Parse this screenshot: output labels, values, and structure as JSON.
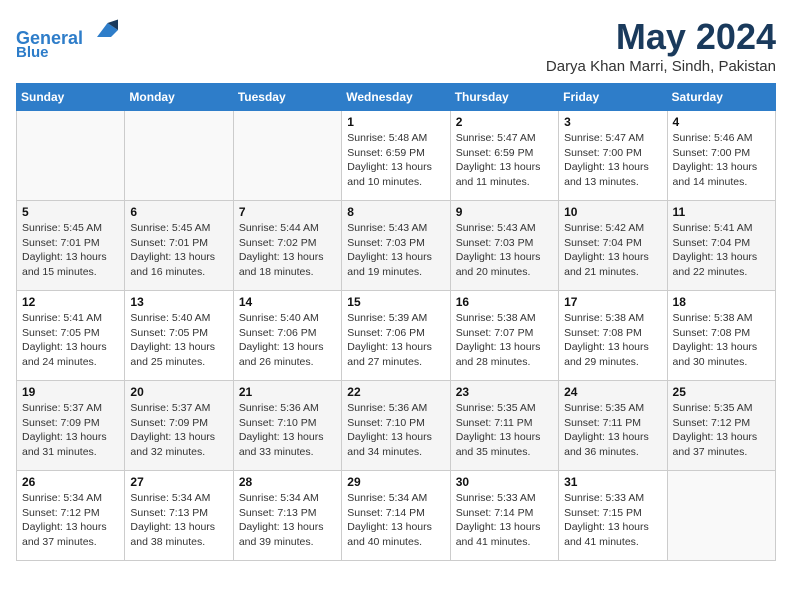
{
  "header": {
    "logo_line1": "General",
    "logo_line2": "Blue",
    "month": "May 2024",
    "location": "Darya Khan Marri, Sindh, Pakistan"
  },
  "weekdays": [
    "Sunday",
    "Monday",
    "Tuesday",
    "Wednesday",
    "Thursday",
    "Friday",
    "Saturday"
  ],
  "weeks": [
    [
      {
        "day": "",
        "info": ""
      },
      {
        "day": "",
        "info": ""
      },
      {
        "day": "",
        "info": ""
      },
      {
        "day": "1",
        "info": "Sunrise: 5:48 AM\nSunset: 6:59 PM\nDaylight: 13 hours\nand 10 minutes."
      },
      {
        "day": "2",
        "info": "Sunrise: 5:47 AM\nSunset: 6:59 PM\nDaylight: 13 hours\nand 11 minutes."
      },
      {
        "day": "3",
        "info": "Sunrise: 5:47 AM\nSunset: 7:00 PM\nDaylight: 13 hours\nand 13 minutes."
      },
      {
        "day": "4",
        "info": "Sunrise: 5:46 AM\nSunset: 7:00 PM\nDaylight: 13 hours\nand 14 minutes."
      }
    ],
    [
      {
        "day": "5",
        "info": "Sunrise: 5:45 AM\nSunset: 7:01 PM\nDaylight: 13 hours\nand 15 minutes."
      },
      {
        "day": "6",
        "info": "Sunrise: 5:45 AM\nSunset: 7:01 PM\nDaylight: 13 hours\nand 16 minutes."
      },
      {
        "day": "7",
        "info": "Sunrise: 5:44 AM\nSunset: 7:02 PM\nDaylight: 13 hours\nand 18 minutes."
      },
      {
        "day": "8",
        "info": "Sunrise: 5:43 AM\nSunset: 7:03 PM\nDaylight: 13 hours\nand 19 minutes."
      },
      {
        "day": "9",
        "info": "Sunrise: 5:43 AM\nSunset: 7:03 PM\nDaylight: 13 hours\nand 20 minutes."
      },
      {
        "day": "10",
        "info": "Sunrise: 5:42 AM\nSunset: 7:04 PM\nDaylight: 13 hours\nand 21 minutes."
      },
      {
        "day": "11",
        "info": "Sunrise: 5:41 AM\nSunset: 7:04 PM\nDaylight: 13 hours\nand 22 minutes."
      }
    ],
    [
      {
        "day": "12",
        "info": "Sunrise: 5:41 AM\nSunset: 7:05 PM\nDaylight: 13 hours\nand 24 minutes."
      },
      {
        "day": "13",
        "info": "Sunrise: 5:40 AM\nSunset: 7:05 PM\nDaylight: 13 hours\nand 25 minutes."
      },
      {
        "day": "14",
        "info": "Sunrise: 5:40 AM\nSunset: 7:06 PM\nDaylight: 13 hours\nand 26 minutes."
      },
      {
        "day": "15",
        "info": "Sunrise: 5:39 AM\nSunset: 7:06 PM\nDaylight: 13 hours\nand 27 minutes."
      },
      {
        "day": "16",
        "info": "Sunrise: 5:38 AM\nSunset: 7:07 PM\nDaylight: 13 hours\nand 28 minutes."
      },
      {
        "day": "17",
        "info": "Sunrise: 5:38 AM\nSunset: 7:08 PM\nDaylight: 13 hours\nand 29 minutes."
      },
      {
        "day": "18",
        "info": "Sunrise: 5:38 AM\nSunset: 7:08 PM\nDaylight: 13 hours\nand 30 minutes."
      }
    ],
    [
      {
        "day": "19",
        "info": "Sunrise: 5:37 AM\nSunset: 7:09 PM\nDaylight: 13 hours\nand 31 minutes."
      },
      {
        "day": "20",
        "info": "Sunrise: 5:37 AM\nSunset: 7:09 PM\nDaylight: 13 hours\nand 32 minutes."
      },
      {
        "day": "21",
        "info": "Sunrise: 5:36 AM\nSunset: 7:10 PM\nDaylight: 13 hours\nand 33 minutes."
      },
      {
        "day": "22",
        "info": "Sunrise: 5:36 AM\nSunset: 7:10 PM\nDaylight: 13 hours\nand 34 minutes."
      },
      {
        "day": "23",
        "info": "Sunrise: 5:35 AM\nSunset: 7:11 PM\nDaylight: 13 hours\nand 35 minutes."
      },
      {
        "day": "24",
        "info": "Sunrise: 5:35 AM\nSunset: 7:11 PM\nDaylight: 13 hours\nand 36 minutes."
      },
      {
        "day": "25",
        "info": "Sunrise: 5:35 AM\nSunset: 7:12 PM\nDaylight: 13 hours\nand 37 minutes."
      }
    ],
    [
      {
        "day": "26",
        "info": "Sunrise: 5:34 AM\nSunset: 7:12 PM\nDaylight: 13 hours\nand 37 minutes."
      },
      {
        "day": "27",
        "info": "Sunrise: 5:34 AM\nSunset: 7:13 PM\nDaylight: 13 hours\nand 38 minutes."
      },
      {
        "day": "28",
        "info": "Sunrise: 5:34 AM\nSunset: 7:13 PM\nDaylight: 13 hours\nand 39 minutes."
      },
      {
        "day": "29",
        "info": "Sunrise: 5:34 AM\nSunset: 7:14 PM\nDaylight: 13 hours\nand 40 minutes."
      },
      {
        "day": "30",
        "info": "Sunrise: 5:33 AM\nSunset: 7:14 PM\nDaylight: 13 hours\nand 41 minutes."
      },
      {
        "day": "31",
        "info": "Sunrise: 5:33 AM\nSunset: 7:15 PM\nDaylight: 13 hours\nand 41 minutes."
      },
      {
        "day": "",
        "info": ""
      }
    ]
  ]
}
